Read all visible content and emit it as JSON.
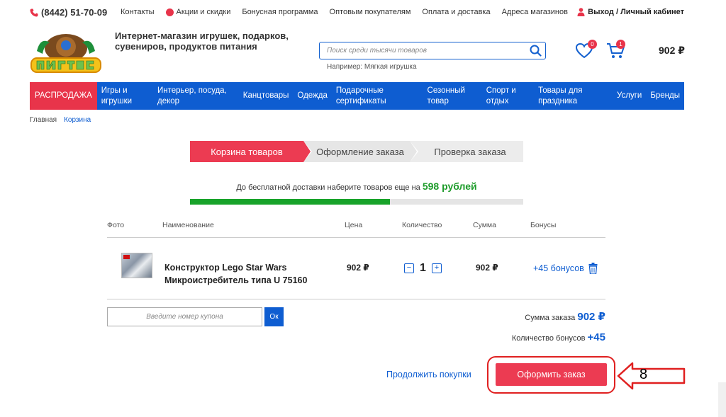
{
  "topbar": {
    "phone": "(8442) 51-70-09",
    "links": [
      "Контакты",
      "Акции и скидки",
      "Бонусная программа",
      "Оптовым покупателям",
      "Оплата и доставка",
      "Адреса магазинов"
    ],
    "login": "Выход / Личный кабинет"
  },
  "header": {
    "tagline": "Интернет-магазин игрушек, подарков, сувениров, продуктов питания",
    "search_placeholder": "Поиск среди тысячи товаров",
    "search_hint": "Например: Мягкая игрушка",
    "fav_count": "0",
    "cart_count": "1",
    "cart_total": "902 ₽"
  },
  "nav": {
    "items": [
      "РАСПРОДАЖА",
      "Игры и игрушки",
      "Интерьер, посуда, декор",
      "Канцтовары",
      "Одежда",
      "Подарочные сертификаты",
      "Сезонный товар",
      "Спорт и отдых",
      "Товары для праздника",
      "Услуги",
      "Бренды"
    ]
  },
  "breadcrumbs": {
    "home": "Главная",
    "current": "Корзина"
  },
  "steps": [
    "Корзина товаров",
    "Оформление заказа",
    "Проверка заказа"
  ],
  "free_shipping": {
    "text": "До бесплатной доставки наберите товаров еще на",
    "amount": "598 рублей",
    "progress": 0.6
  },
  "table": {
    "headers": [
      "Фото",
      "Наименование",
      "Цена",
      "Количество",
      "Сумма",
      "Бонусы"
    ],
    "rows": [
      {
        "name": "Конструктор Lego Star Wars Микроистребитель типа U 75160",
        "price": "902 ₽",
        "qty": "1",
        "sum": "902 ₽",
        "bonus": "+45 бонусов"
      }
    ]
  },
  "coupon": {
    "placeholder": "Введите номер купона",
    "button": "Ок"
  },
  "totals": {
    "order_label": "Сумма заказа",
    "order_value": "902 ₽",
    "bonus_label": "Количество бонусов",
    "bonus_value": "+45"
  },
  "actions": {
    "continue": "Продолжить покупки",
    "checkout": "Оформить заказ"
  },
  "annotation": {
    "step_number": "8"
  },
  "colors": {
    "brand_blue": "#0e5dd1",
    "accent_red": "#ec3b52",
    "progress_green": "#18a32a"
  }
}
